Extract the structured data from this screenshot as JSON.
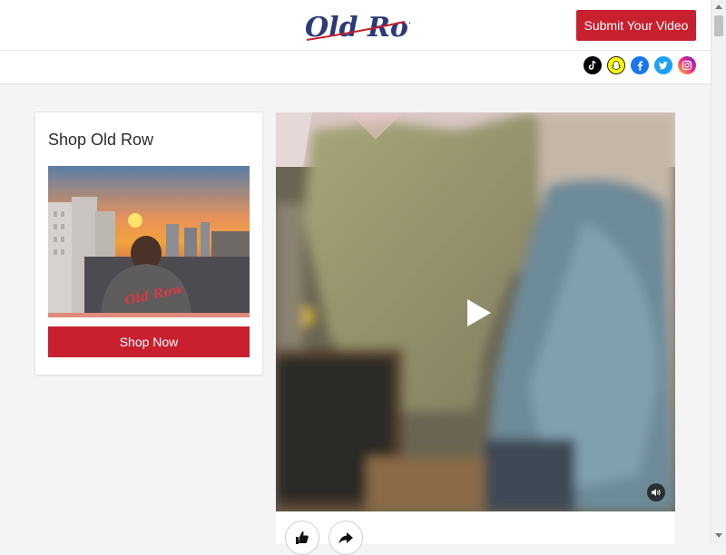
{
  "header": {
    "logo_text": "Old Row",
    "submit_label": "Submit Your Video"
  },
  "social": [
    "tiktok-icon",
    "snapchat-icon",
    "facebook-icon",
    "twitter-icon",
    "instagram-icon"
  ],
  "sidebar": {
    "title": "Shop Old Row",
    "shirt_text": "Old Row",
    "shop_label": "Shop Now"
  },
  "video": {
    "play_icon": "play-icon",
    "mute_icon": "volume-icon"
  },
  "actions": [
    "thumbs-up-icon",
    "share-icon"
  ],
  "colors": {
    "accent": "#c8202f",
    "logo_blue": "#2a3a7a"
  }
}
